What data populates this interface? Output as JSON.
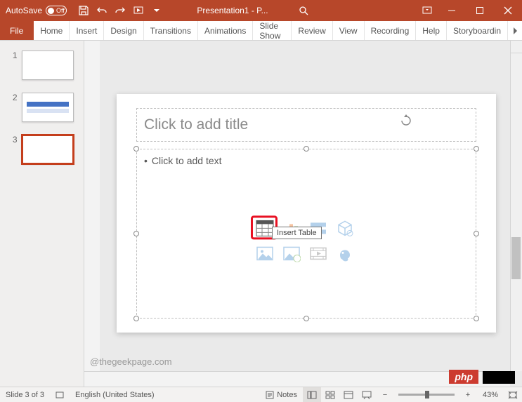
{
  "titlebar": {
    "autosave_label": "AutoSave",
    "autosave_state": "Off",
    "doc_title": "Presentation1 - P..."
  },
  "ribbon": {
    "file": "File",
    "tabs": [
      "Home",
      "Insert",
      "Design",
      "Transitions",
      "Animations",
      "Slide Show",
      "Review",
      "View",
      "Recording",
      "Help",
      "Storyboardin"
    ]
  },
  "thumbnails": [
    {
      "num": "1",
      "selected": false,
      "variant": "blank"
    },
    {
      "num": "2",
      "selected": false,
      "variant": "bars"
    },
    {
      "num": "3",
      "selected": true,
      "variant": "blank"
    }
  ],
  "slide": {
    "title_placeholder": "Click to add title",
    "content_placeholder": "Click to add text",
    "tooltip": "Insert Table"
  },
  "watermark": "@thegeekpage.com",
  "statusbar": {
    "slide_info": "Slide 3 of 3",
    "language": "English (United States)",
    "notes_label": "Notes",
    "zoom": "43%"
  },
  "badges": {
    "php": "php"
  }
}
